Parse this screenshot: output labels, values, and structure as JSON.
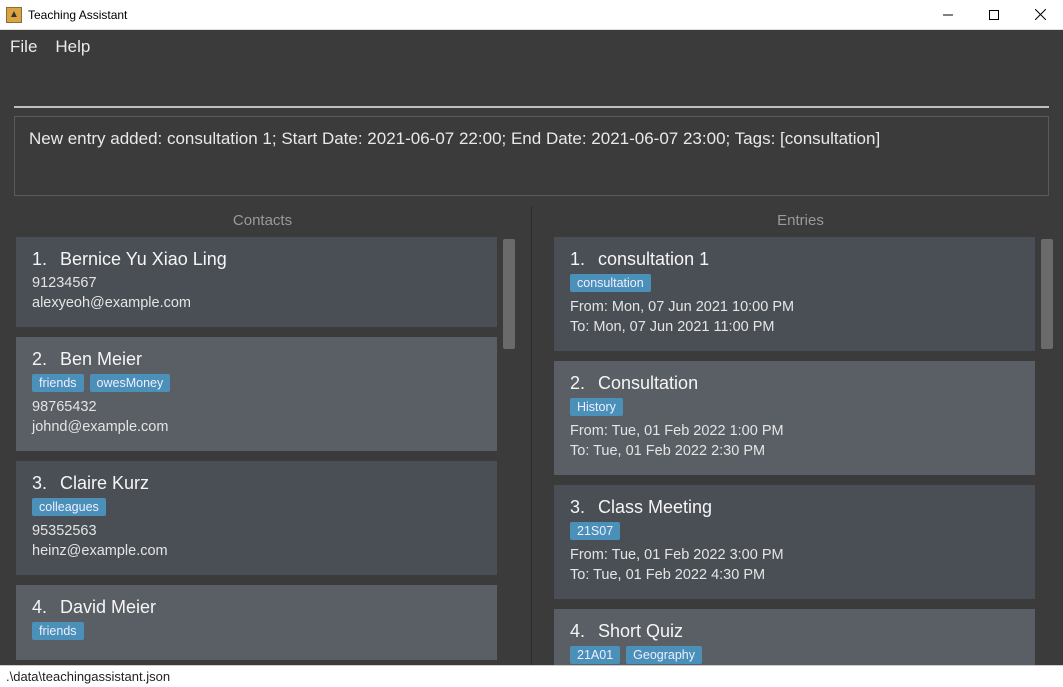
{
  "window": {
    "title": "Teaching Assistant"
  },
  "menu": {
    "file": "File",
    "help": "Help"
  },
  "result": "New entry added: consultation 1; Start Date: 2021-06-07 22:00; End Date: 2021-06-07 23:00; Tags: [consultation]",
  "panels": {
    "contacts_header": "Contacts",
    "entries_header": "Entries"
  },
  "contacts": [
    {
      "idx": "1.",
      "name": "Bernice Yu Xiao Ling",
      "tags": [],
      "phone": "91234567",
      "email": "alexyeoh@example.com",
      "alt": false
    },
    {
      "idx": "2.",
      "name": "Ben Meier",
      "tags": [
        "friends",
        "owesMoney"
      ],
      "phone": "98765432",
      "email": "johnd@example.com",
      "alt": true
    },
    {
      "idx": "3.",
      "name": "Claire Kurz",
      "tags": [
        "colleagues"
      ],
      "phone": "95352563",
      "email": "heinz@example.com",
      "alt": false
    },
    {
      "idx": "4.",
      "name": "David Meier",
      "tags": [
        "friends"
      ],
      "phone": "",
      "email": "",
      "alt": true
    }
  ],
  "entries": [
    {
      "idx": "1.",
      "name": "consultation 1",
      "tags": [
        "consultation"
      ],
      "from": "From: Mon, 07 Jun 2021 10:00 PM",
      "to": "To: Mon, 07 Jun 2021 11:00 PM",
      "alt": false
    },
    {
      "idx": "2.",
      "name": "Consultation",
      "tags": [
        "History"
      ],
      "from": "From: Tue, 01 Feb 2022 1:00 PM",
      "to": "To: Tue, 01 Feb 2022 2:30 PM",
      "alt": true
    },
    {
      "idx": "3.",
      "name": "Class Meeting",
      "tags": [
        "21S07"
      ],
      "from": "From: Tue, 01 Feb 2022 3:00 PM",
      "to": "To: Tue, 01 Feb 2022 4:30 PM",
      "alt": false
    },
    {
      "idx": "4.",
      "name": "Short Quiz",
      "tags": [
        "21A01",
        "Geography"
      ],
      "from": "",
      "to": "",
      "alt": true
    }
  ],
  "status": ".\\data\\teachingassistant.json"
}
